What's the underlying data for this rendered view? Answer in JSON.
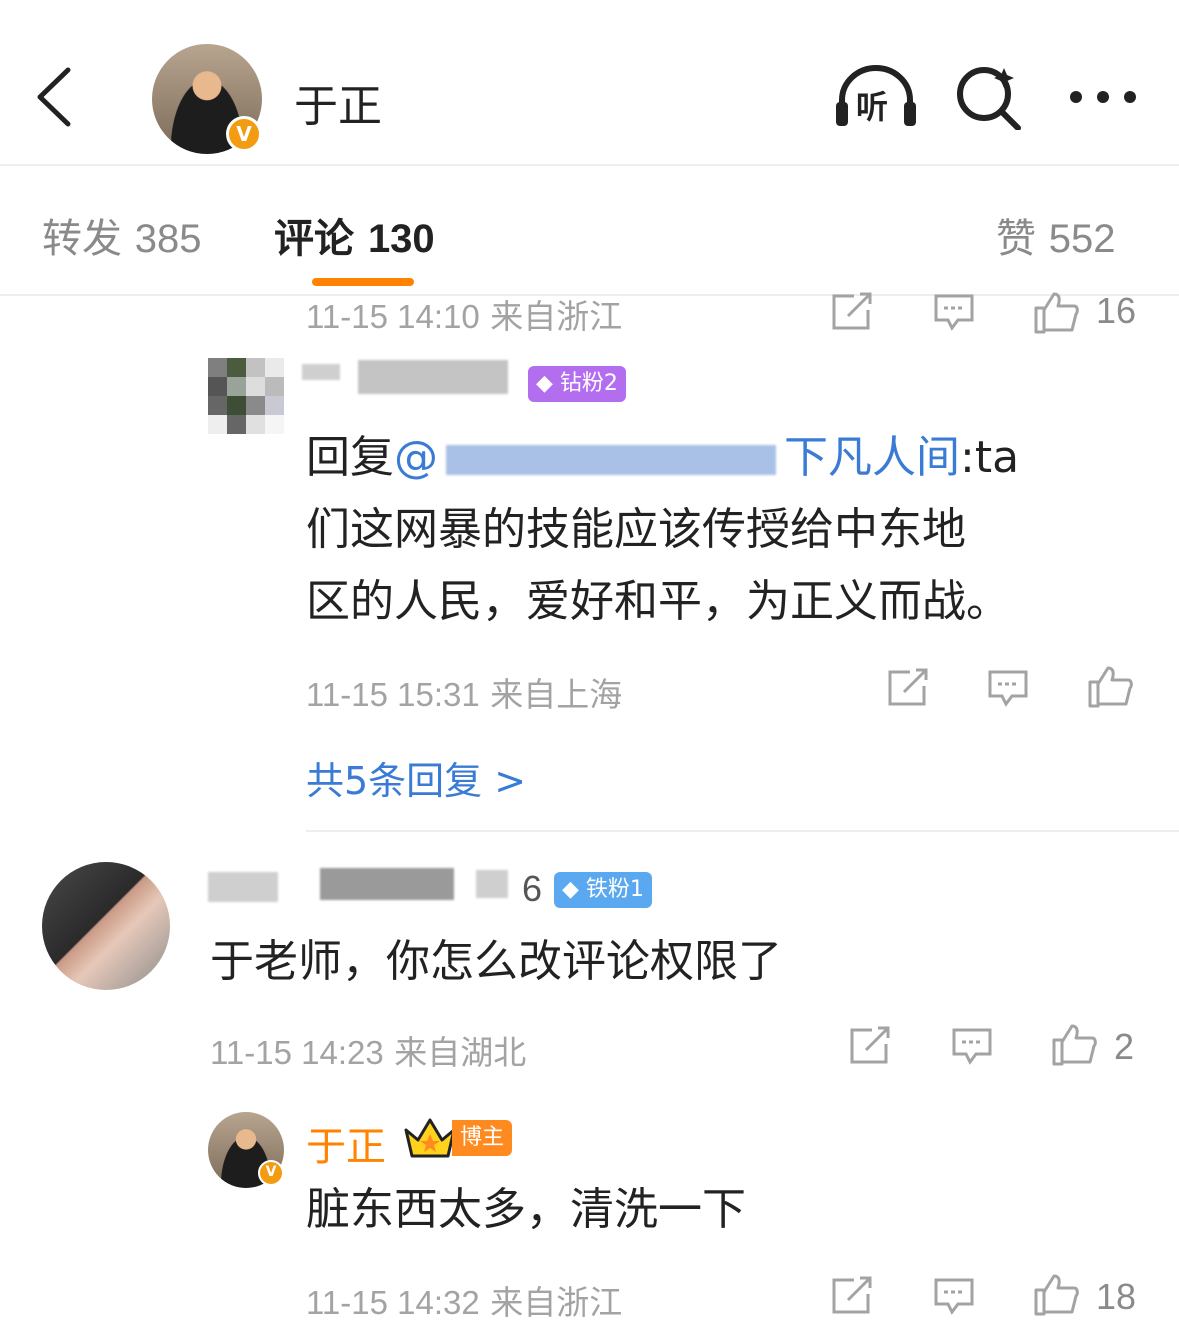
{
  "header": {
    "title": "于正",
    "listen_label": "听",
    "verified_mark": "V"
  },
  "tabs": {
    "repost": {
      "label": "转发",
      "count": "385"
    },
    "comment": {
      "label": "评论",
      "count": "130"
    },
    "like": {
      "label": "赞",
      "count": "552"
    }
  },
  "top_meta": {
    "time": "11-15 14:10",
    "location": "来自浙江",
    "likes": "16"
  },
  "reply1": {
    "badge": "钻粉2",
    "prefix": "回复",
    "mention_visible": "@",
    "mention_tail": "下凡人间",
    "text_after_mention": ":ta",
    "line2": "们这网暴的技能应该传授给中东地",
    "line3": "区的人民，爱好和平，为正义而战。",
    "time": "11-15 15:31",
    "location": "来自上海",
    "more_replies": "共5条回复 >"
  },
  "comment2": {
    "name_tail": "6",
    "badge": "铁粉1",
    "text": "于老师，你怎么改评论权限了",
    "time": "11-15 14:23",
    "location": "来自湖北",
    "likes": "2"
  },
  "reply2": {
    "name": "于正",
    "badge": "博主",
    "text": "脏东西太多，清洗一下",
    "time": "11-15 14:32",
    "location": "来自浙江",
    "likes": "18"
  },
  "colors": {
    "accent": "#ff8200",
    "link": "#3a7bd5",
    "diamond_badge": "#b36ef0",
    "iron_badge": "#5aa8ef",
    "host_badge": "#ff8a1f"
  },
  "icons": [
    "back-icon",
    "listen-icon",
    "search-icon",
    "more-icon",
    "share-icon",
    "comment-icon",
    "like-icon",
    "verify-badge",
    "diamond-icon",
    "crown-icon"
  ]
}
